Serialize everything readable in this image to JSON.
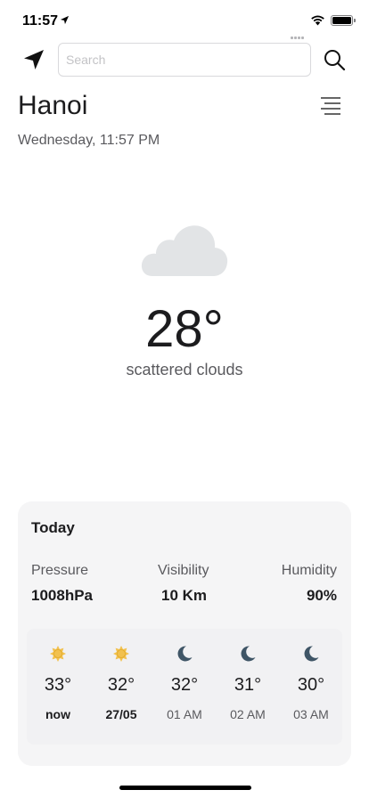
{
  "status": {
    "time": "11:57"
  },
  "search": {
    "placeholder": "Search",
    "value": ""
  },
  "location": {
    "city": "Hanoi",
    "datetime": "Wednesday, 11:57 PM"
  },
  "current": {
    "icon": "cloud-icon",
    "temperature": "28°",
    "description": "scattered clouds"
  },
  "today": {
    "title": "Today",
    "stats": [
      {
        "label": "Pressure",
        "value": "1008hPa"
      },
      {
        "label": "Visibility",
        "value": "10 Km"
      },
      {
        "label": "Humidity",
        "value": "90%"
      }
    ],
    "forecast": [
      {
        "icon": "sun-icon",
        "temp": "33°",
        "time": "now"
      },
      {
        "icon": "sun-icon",
        "temp": "32°",
        "time": "27/05"
      },
      {
        "icon": "moon-icon",
        "temp": "32°",
        "time": "01 AM"
      },
      {
        "icon": "moon-icon",
        "temp": "31°",
        "time": "02 AM"
      },
      {
        "icon": "moon-icon",
        "temp": "30°",
        "time": "03 AM"
      }
    ]
  },
  "colors": {
    "sun": "#f2c14e",
    "moon": "#3f5566",
    "cloud": "#e2e4e6",
    "card": "#f5f5f6"
  }
}
